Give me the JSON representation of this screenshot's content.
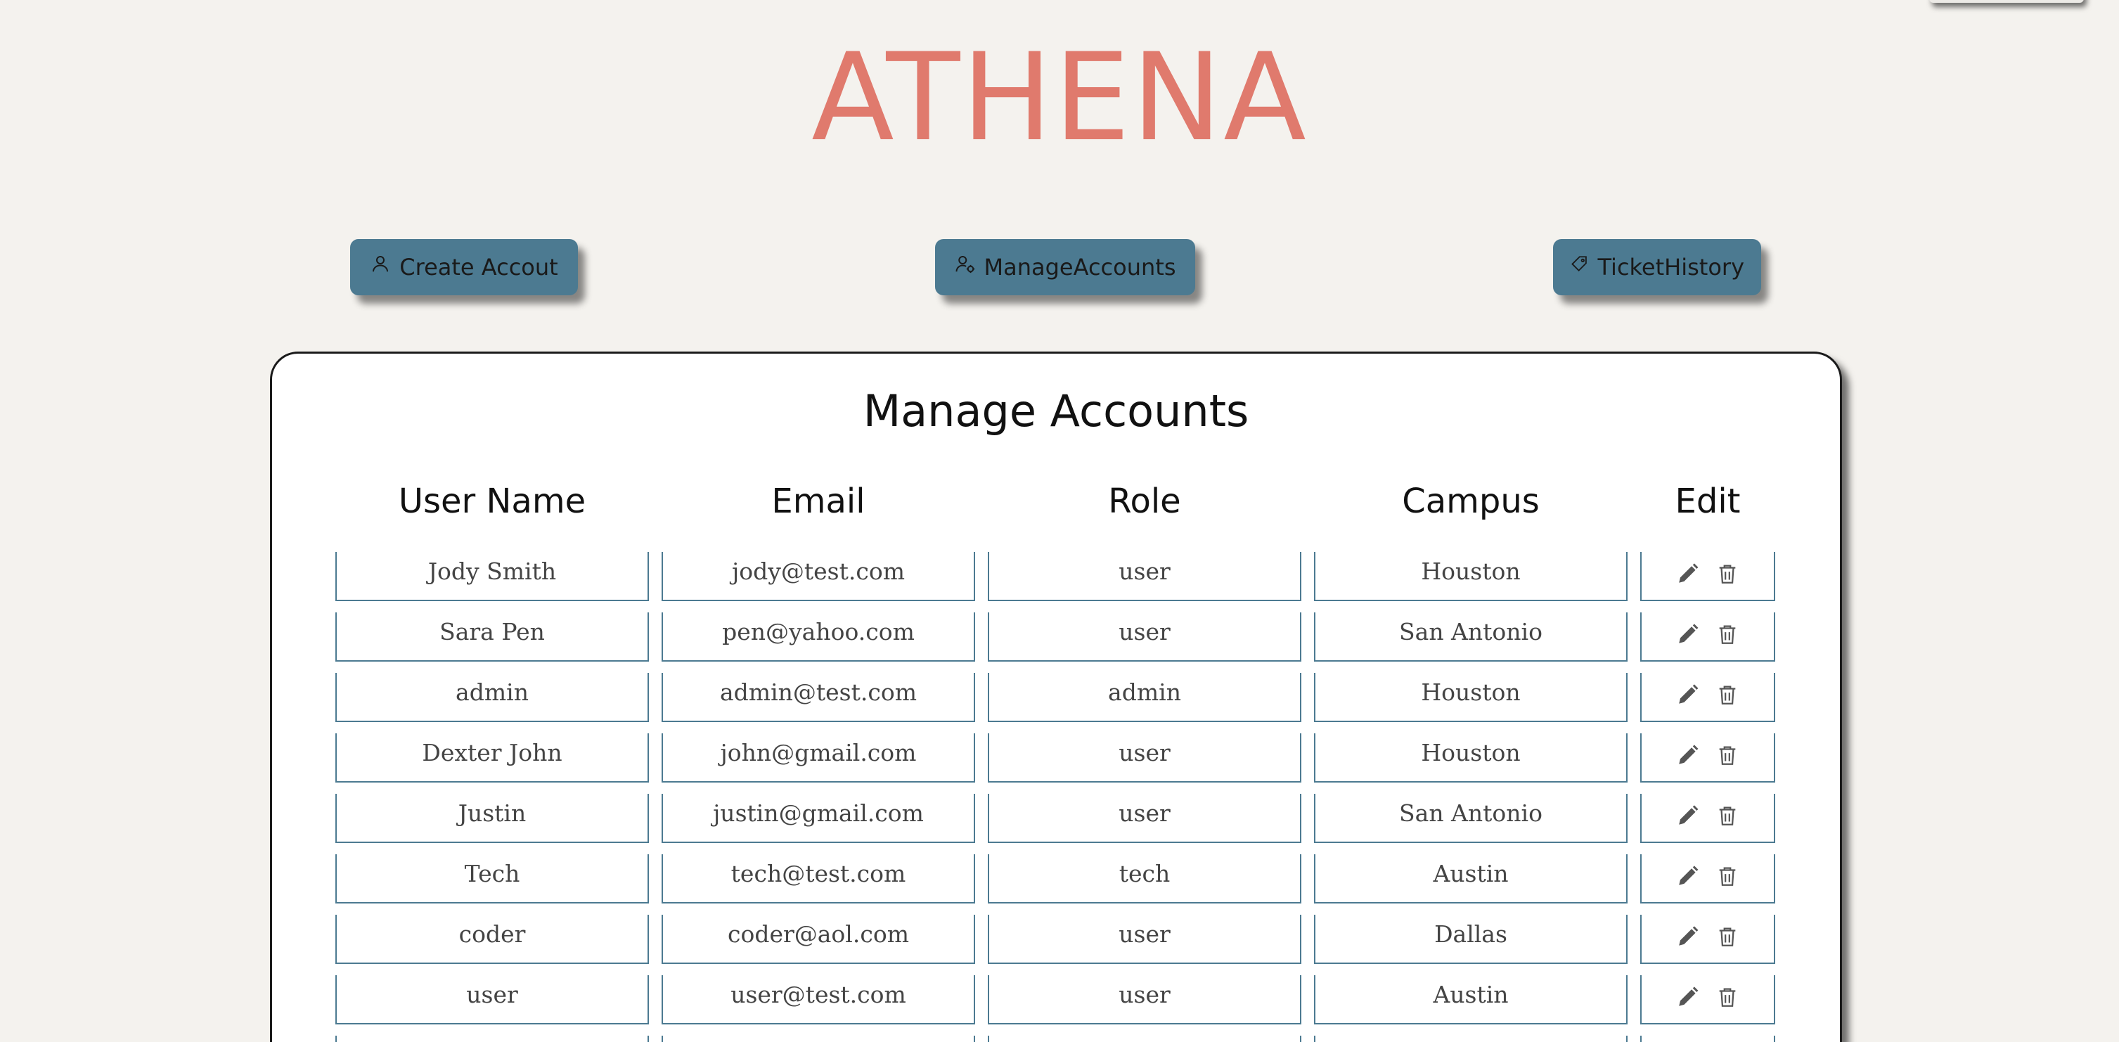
{
  "app": {
    "brand": "ATHENA"
  },
  "nav": {
    "create_label": "Create Accout",
    "manage_label": "ManageAccounts",
    "history_label": "TicketHistory"
  },
  "card": {
    "title": "Manage Accounts"
  },
  "table": {
    "columns": [
      "User Name",
      "Email",
      "Role",
      "Campus",
      "Edit"
    ],
    "rows": [
      {
        "name": "Jody Smith",
        "email": "jody@test.com",
        "role": "user",
        "campus": "Houston"
      },
      {
        "name": "Sara Pen",
        "email": "pen@yahoo.com",
        "role": "user",
        "campus": "San Antonio"
      },
      {
        "name": "admin",
        "email": "admin@test.com",
        "role": "admin",
        "campus": "Houston"
      },
      {
        "name": "Dexter John",
        "email": "john@gmail.com",
        "role": "user",
        "campus": "Houston"
      },
      {
        "name": "Justin",
        "email": "justin@gmail.com",
        "role": "user",
        "campus": "San Antonio"
      },
      {
        "name": "Tech",
        "email": "tech@test.com",
        "role": "tech",
        "campus": "Austin"
      },
      {
        "name": "coder",
        "email": "coder@aol.com",
        "role": "user",
        "campus": "Dallas"
      },
      {
        "name": "user",
        "email": "user@test.com",
        "role": "user",
        "campus": "Austin"
      },
      {
        "name": "",
        "email": "",
        "role": "",
        "campus": ""
      }
    ],
    "row_actions": [
      "pencil-icon",
      "trash-icon"
    ]
  },
  "colors": {
    "background": "#f4f2ee",
    "brand": "#e07a6d",
    "button": "#4c7a91",
    "cell_border": "#4c7a91",
    "text": "#444444"
  }
}
